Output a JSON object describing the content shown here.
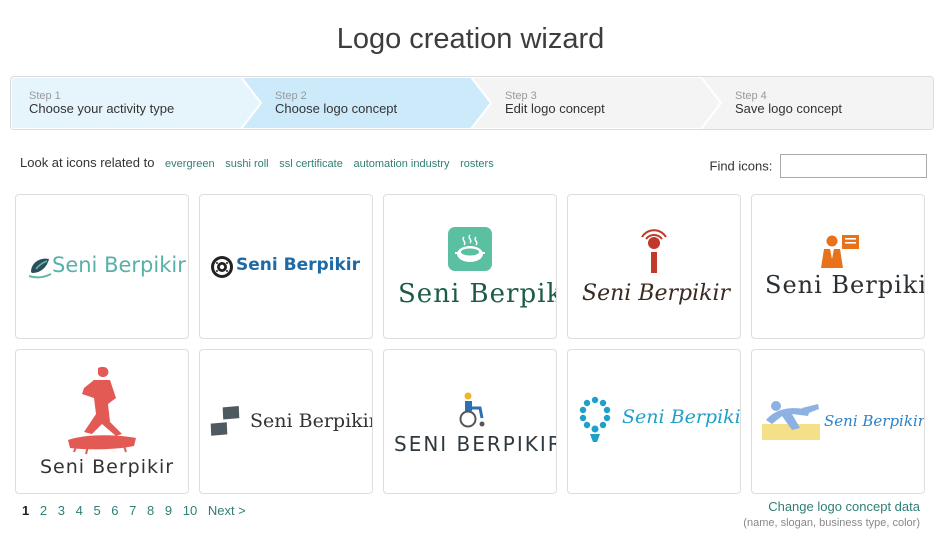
{
  "page": {
    "title": "Logo creation wizard"
  },
  "steps": [
    {
      "num": "Step 1",
      "label": "Choose your activity type",
      "state": "done"
    },
    {
      "num": "Step 2",
      "label": "Choose logo concept",
      "state": "active"
    },
    {
      "num": "Step 3",
      "label": "Edit logo concept",
      "state": "todo"
    },
    {
      "num": "Step 4",
      "label": "Save logo concept",
      "state": "todo"
    }
  ],
  "related": {
    "prefix": "Look at icons related to",
    "links": [
      "evergreen",
      "sushi roll",
      "ssl certificate",
      "automation industry",
      "rosters"
    ]
  },
  "find": {
    "label": "Find icons:",
    "value": ""
  },
  "logos": [
    {
      "text": "Seni Berpikir",
      "icon": "leaf-swoosh-icon"
    },
    {
      "text": "Seni Berpikir",
      "icon": "sushi-roll-icon"
    },
    {
      "text": "Seni Berpikir",
      "icon": "steaming-pot-icon"
    },
    {
      "text": "Seni Berpikir",
      "icon": "wireless-antenna-icon"
    },
    {
      "text": "Seni Berpikir",
      "icon": "businessman-presentation-icon"
    },
    {
      "text": "Seni Berpikir",
      "icon": "surfer-icon"
    },
    {
      "text": "Seni Berpikir",
      "icon": "footprints-icon"
    },
    {
      "text": "SENI BERPIKIR",
      "icon": "wheelchair-user-icon"
    },
    {
      "text": "Seni Berpikir",
      "icon": "prayer-beads-icon"
    },
    {
      "text": "Seni Berpikir",
      "icon": "swimmer-icon"
    }
  ],
  "pagination": {
    "pages": [
      "1",
      "2",
      "3",
      "4",
      "5",
      "6",
      "7",
      "8",
      "9",
      "10"
    ],
    "current": "1",
    "next": "Next >"
  },
  "change": {
    "link": "Change logo concept data",
    "hint": "(name, slogan, business type, color)"
  },
  "colors": {
    "accent": "#2f7f76",
    "step_done": "#e6f4fb",
    "step_active": "#cdeafb",
    "step_todo": "#f4f4f4"
  }
}
